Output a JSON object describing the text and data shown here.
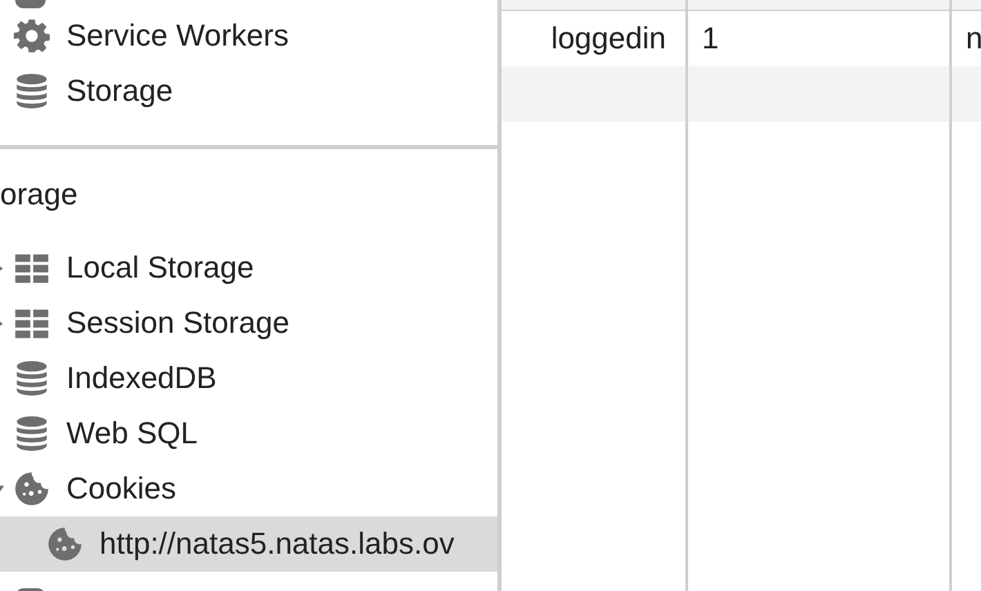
{
  "sidebar": {
    "top_items": [
      {
        "label": "Service Workers",
        "kind": "gear",
        "selected": false
      },
      {
        "label": "Storage",
        "kind": "database",
        "selected": false
      }
    ],
    "storage_section": {
      "heading": "orage",
      "items": [
        {
          "label": "Local Storage",
          "kind": "grid",
          "expanded": false,
          "selected": false
        },
        {
          "label": "Session Storage",
          "kind": "grid",
          "expanded": false,
          "selected": false
        },
        {
          "label": "IndexedDB",
          "kind": "database",
          "selected": false
        },
        {
          "label": "Web SQL",
          "kind": "database",
          "selected": false
        },
        {
          "label": "Cookies",
          "kind": "cookie",
          "expanded": true,
          "selected": false,
          "children": [
            {
              "label": "http://natas5.natas.labs.ov",
              "kind": "cookie",
              "selected": true
            }
          ]
        }
      ]
    }
  },
  "table": {
    "rows": [
      {
        "cells": [
          "loggedin",
          "1",
          "n"
        ],
        "selected": false
      }
    ]
  }
}
